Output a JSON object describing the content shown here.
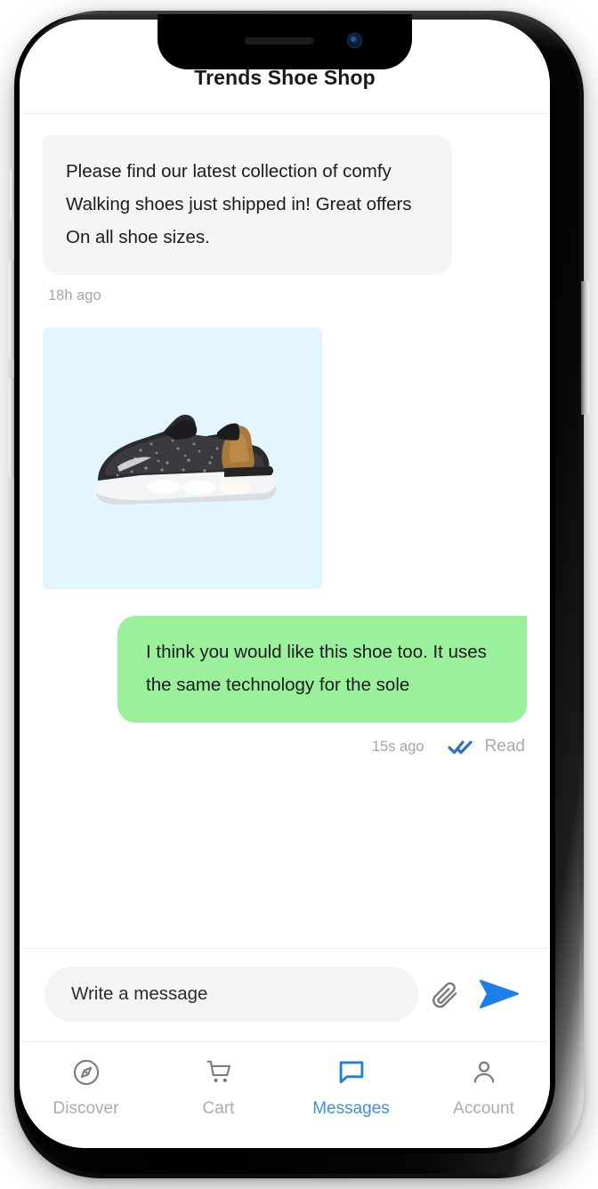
{
  "header": {
    "title": "Trends Shoe Shop"
  },
  "conversation": {
    "incoming": {
      "text": "Please find our latest collection of comfy Walking shoes just shipped in! Great offers On all shoe sizes.",
      "time": "18h ago"
    },
    "attachment": {
      "alt": "walking shoe photo",
      "background": "#e4f6fd"
    },
    "outgoing": {
      "text": "I think you would like this shoe too. It uses the same technology for the sole",
      "time": "15s ago",
      "status": "Read",
      "status_color": "#2f6fc4"
    }
  },
  "composer": {
    "placeholder": "Write a message",
    "value": "",
    "attach_icon": "paperclip-icon",
    "send_icon": "send-icon",
    "send_color": "#1c7ee8"
  },
  "tabbar": {
    "active": "Messages",
    "active_color": "#3d8fe0",
    "inactive_color": "#a9acb1",
    "items": [
      {
        "label": "Discover",
        "icon": "compass-icon"
      },
      {
        "label": "Cart",
        "icon": "shopping-cart-icon"
      },
      {
        "label": "Messages",
        "icon": "chat-bubble-icon"
      },
      {
        "label": "Account",
        "icon": "person-icon"
      }
    ]
  }
}
